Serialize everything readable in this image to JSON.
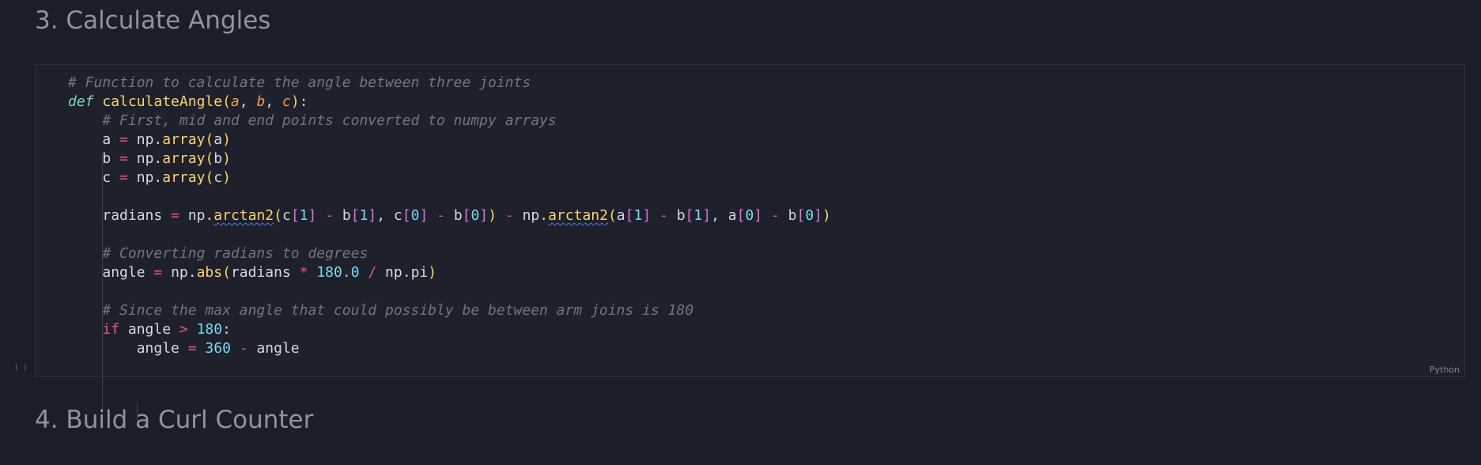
{
  "headings": {
    "section3": "3. Calculate Angles",
    "section4": "4. Build a Curl Counter"
  },
  "cell": {
    "exec_count": "[ ]",
    "language": "Python",
    "lines": {
      "l1": "# Function to calculate the angle between three joints",
      "l3": "# First, mid and end points converted to numpy arrays",
      "l9": "# Converting radians to degrees",
      "l12": "# Since the max angle that could possibly be between arm joins is 180"
    }
  },
  "colors": {
    "background": "#1b1e28",
    "cell_background": "#1e212c",
    "comment": "#6d7587",
    "keyword": "#f0547a",
    "function": "#fbd46d",
    "parameter": "#f89a52",
    "number": "#78d8f0"
  }
}
